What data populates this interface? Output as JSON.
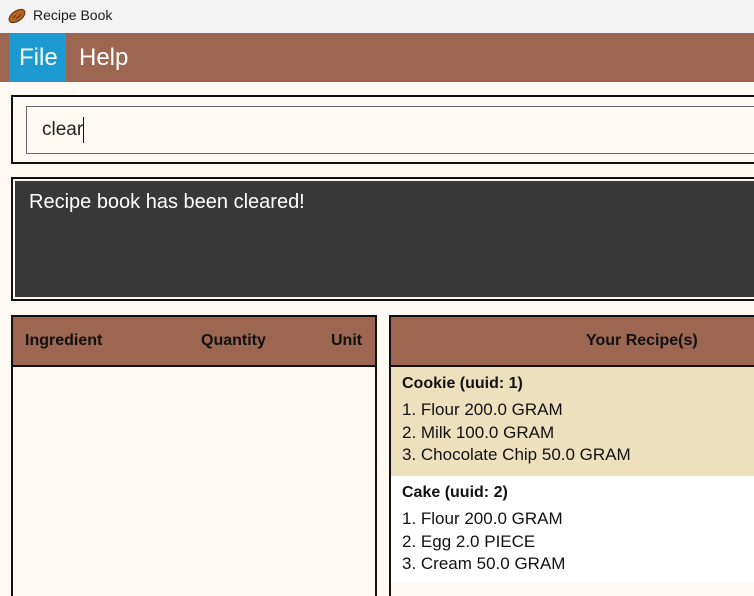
{
  "window": {
    "title": "Recipe Book",
    "icon": "recipe-book-app-icon"
  },
  "menu": {
    "file": "File",
    "help": "Help"
  },
  "command": {
    "value": "clear"
  },
  "result": {
    "message": "Recipe book has been cleared!"
  },
  "ingredients_panel": {
    "col_ingredient": "Ingredient",
    "col_quantity": "Quantity",
    "col_unit": "Unit",
    "rows": []
  },
  "recipes_panel": {
    "header": "Your Recipe(s)",
    "recipes": [
      {
        "title": "Cookie (uuid: 1)",
        "lines": [
          "1. Flour 200.0 GRAM",
          "2. Milk 100.0 GRAM",
          "3. Chocolate Chip 50.0 GRAM"
        ]
      },
      {
        "title": "Cake (uuid: 2)",
        "lines": [
          "1. Flour 200.0 GRAM",
          "2. Egg 2.0 PIECE",
          "3. Cream 50.0 GRAM"
        ]
      }
    ]
  },
  "colors": {
    "accent_brown": "#9d6650",
    "menu_selected": "#1b9bd1",
    "result_bg": "#383838",
    "panel_bg": "#fefaf3",
    "card_selected_bg": "#ede1bd"
  }
}
